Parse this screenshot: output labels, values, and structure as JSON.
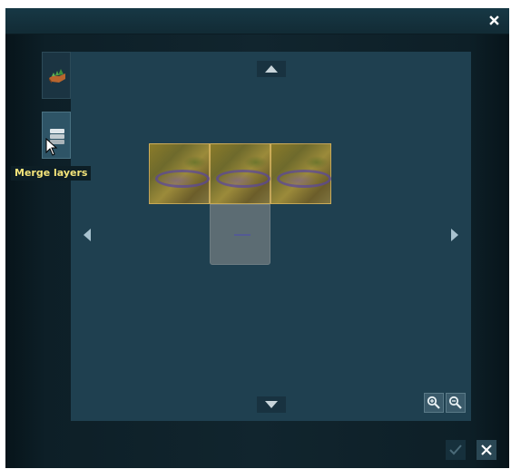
{
  "window": {
    "close_label": "×"
  },
  "sidebar": {
    "items": [
      {
        "name": "terrain-layer",
        "icon": "terrain-icon"
      },
      {
        "name": "merge-layers",
        "icon": "layers-icon"
      }
    ]
  },
  "tooltip": {
    "text": "Merge layers"
  },
  "map": {
    "tiles": [
      {
        "kind": "satellite"
      },
      {
        "kind": "satellite"
      },
      {
        "kind": "satellite"
      },
      {
        "kind": "empty"
      }
    ]
  },
  "colors": {
    "accent_tooltip": "#f4e47a",
    "map_bg": "#1f4050",
    "window_bg": "#11252e"
  }
}
